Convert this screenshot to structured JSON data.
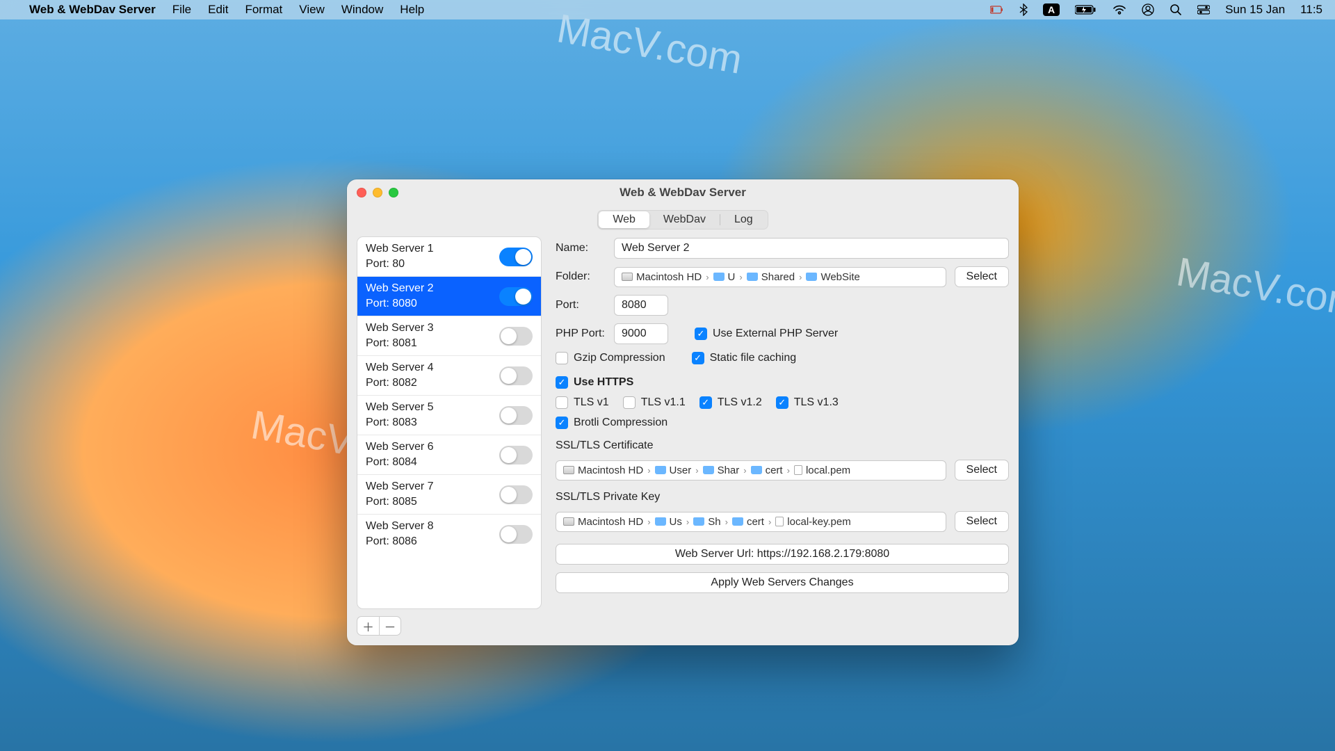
{
  "menubar": {
    "app_name": "Web & WebDav Server",
    "items": [
      "File",
      "Edit",
      "Format",
      "View",
      "Window",
      "Help"
    ],
    "status": {
      "a_indicator": "A",
      "date": "Sun 15 Jan",
      "time": "11:5"
    }
  },
  "window": {
    "title": "Web & WebDav Server",
    "tabs": {
      "web": "Web",
      "webdav": "WebDav",
      "log": "Log",
      "active": "web"
    }
  },
  "servers": [
    {
      "name": "Web Server 1",
      "port": "Port: 80",
      "enabled": true,
      "selected": false
    },
    {
      "name": "Web Server 2",
      "port": "Port: 8080",
      "enabled": true,
      "selected": true
    },
    {
      "name": "Web Server 3",
      "port": "Port: 8081",
      "enabled": false,
      "selected": false
    },
    {
      "name": "Web Server 4",
      "port": "Port: 8082",
      "enabled": false,
      "selected": false
    },
    {
      "name": "Web Server 5",
      "port": "Port: 8083",
      "enabled": false,
      "selected": false
    },
    {
      "name": "Web Server 6",
      "port": "Port: 8084",
      "enabled": false,
      "selected": false
    },
    {
      "name": "Web Server 7",
      "port": "Port: 8085",
      "enabled": false,
      "selected": false
    },
    {
      "name": "Web Server 8",
      "port": "Port: 8086",
      "enabled": false,
      "selected": false
    }
  ],
  "labels": {
    "name": "Name:",
    "folder": "Folder:",
    "port": "Port:",
    "php_port": "PHP Port:",
    "select": "Select",
    "gzip": "Gzip Compression",
    "external_php": "Use External PHP Server",
    "static_cache": "Static file caching",
    "use_https": "Use HTTPS",
    "tls_v1": "TLS v1",
    "tls_v11": "TLS v1.1",
    "tls_v12": "TLS v1.2",
    "tls_v13": "TLS v1.3",
    "brotli": "Brotli Compression",
    "cert": "SSL/TLS Certificate",
    "key": "SSL/TLS Private Key",
    "url": "Web Server Url: https://192.168.2.179:8080",
    "apply": "Apply Web Servers Changes"
  },
  "form": {
    "name_value": "Web Server 2",
    "port_value": "8080",
    "php_port_value": "9000",
    "folder_path": [
      "Macintosh HD",
      "U",
      "Shared",
      "WebSite"
    ],
    "cert_path": [
      "Macintosh HD",
      "User",
      "Shar",
      "cert",
      "local.pem"
    ],
    "key_path": [
      "Macintosh HD",
      "Us",
      "Sh",
      "cert",
      "local-key.pem"
    ],
    "checks": {
      "external_php": true,
      "gzip": false,
      "static_cache": true,
      "use_https": true,
      "tls_v1": false,
      "tls_v11": false,
      "tls_v12": true,
      "tls_v13": true,
      "brotli": true
    }
  },
  "watermark": "MacV.com"
}
